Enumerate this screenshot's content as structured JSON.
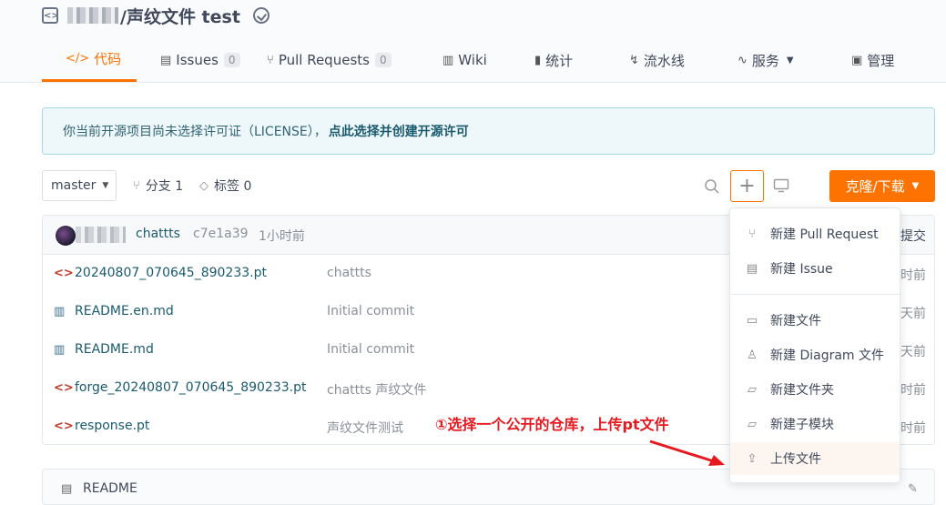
{
  "repo": {
    "title": "/声纹文件 test"
  },
  "tabs": [
    {
      "icon": "</>",
      "label": "代码",
      "active": true
    },
    {
      "icon": "▤",
      "label": "Issues",
      "count": "0"
    },
    {
      "icon": "⑂",
      "label": "Pull Requests",
      "count": "0"
    },
    {
      "icon": "▥",
      "label": "Wiki"
    },
    {
      "icon": "▮",
      "label": "统计"
    },
    {
      "icon": "↯",
      "label": "流水线"
    },
    {
      "icon": "∿",
      "label": "服务"
    },
    {
      "icon": "▣",
      "label": "管理"
    }
  ],
  "license": {
    "text": "你当前开源项目尚未选择许可证（LICENSE），",
    "link": "点此选择并创建开源许可"
  },
  "branch": {
    "name": "master"
  },
  "meta": {
    "branches": "分支 1",
    "tags": "标签 0"
  },
  "clone": {
    "label": "克隆/下载"
  },
  "commit": {
    "author": "chattts",
    "sha": "c7e1a39",
    "time": "1小时前",
    "right": "提交"
  },
  "files": [
    {
      "type": "code",
      "name": "20240807_070645_890233.pt",
      "message": "chattts",
      "time": "时前"
    },
    {
      "type": "doc",
      "name": "README.en.md",
      "message": "Initial commit",
      "time": "天前"
    },
    {
      "type": "doc",
      "name": "README.md",
      "message": "Initial commit",
      "time": "天前"
    },
    {
      "type": "code",
      "name": "forge_20240807_070645_890233.pt",
      "message": "chattts 声纹文件",
      "time": "时前"
    },
    {
      "type": "code",
      "name": "response.pt",
      "message": "声纹文件测试",
      "time": "时前"
    }
  ],
  "readme": {
    "label": "README"
  },
  "dropdown": [
    {
      "icon": "⑂",
      "label": "新建 Pull Request"
    },
    {
      "icon": "▤",
      "label": "新建 Issue"
    },
    {
      "icon": "▭",
      "label": "新建文件"
    },
    {
      "icon": "♙",
      "label": "新建 Diagram 文件"
    },
    {
      "icon": "▱",
      "label": "新建文件夹"
    },
    {
      "icon": "▱",
      "label": "新建子模块"
    },
    {
      "icon": "⇪",
      "label": "上传文件"
    }
  ],
  "annotation": "①选择一个公开的仓库，上传pt文件",
  "colors": {
    "accent": "#fe7300",
    "annotation": "#e5191f",
    "link": "#1a5a6e"
  }
}
